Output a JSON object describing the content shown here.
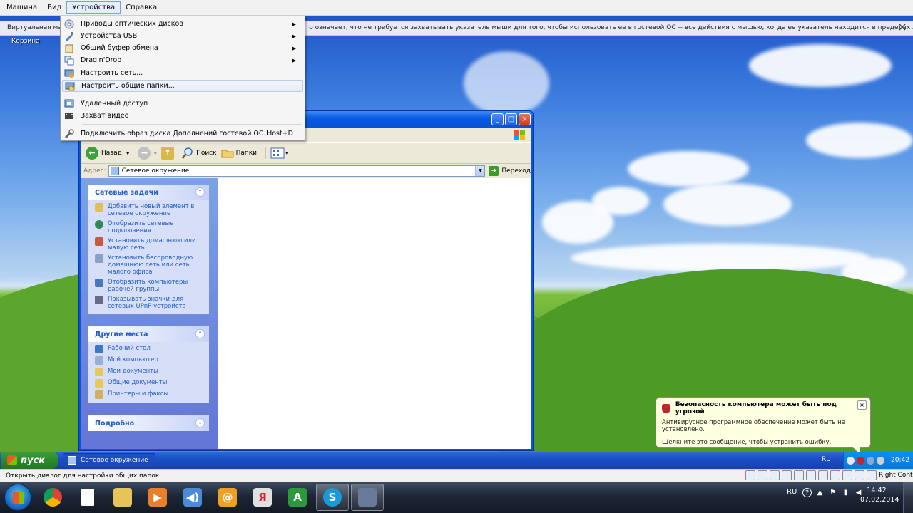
{
  "vbox_menu": {
    "items": [
      "Машина",
      "Вид",
      "Устройства",
      "Справка"
    ],
    "active_index": 2
  },
  "vbox_notice": {
    "text_left": "Виртуальная маш",
    "text_right": "то означает, что не требуется захватывать указатель мыши для того, чтобы использовать ее в гостевой ОС -- все действия с мышью, когда ее указатель находится в пределах экрана виртуальной"
  },
  "desktop": {
    "recycle_label": "Корзина"
  },
  "devices_menu": {
    "items": [
      {
        "label": "Приводы оптических дисков",
        "submenu": true,
        "icon": "optical-disc-icon"
      },
      {
        "label": "Устройства USB",
        "submenu": true,
        "icon": "usb-icon"
      },
      {
        "label": "Общий буфер обмена",
        "submenu": true,
        "icon": "clipboard-icon"
      },
      {
        "label": "Drag'n'Drop",
        "submenu": true,
        "icon": "drag-drop-icon"
      },
      {
        "label": "Настроить сеть...",
        "submenu": false,
        "icon": "network-settings-icon"
      },
      {
        "label": "Настроить общие папки...",
        "submenu": false,
        "icon": "shared-folders-icon"
      },
      {
        "label": "Удаленный доступ",
        "submenu": false,
        "icon": "remote-display-icon"
      },
      {
        "label": "Захват видео",
        "submenu": false,
        "icon": "video-capture-icon"
      },
      {
        "label": "Подключить образ диска Дополнений гостевой ОС...",
        "submenu": false,
        "icon": "guest-additions-icon",
        "shortcut": "Host+D"
      }
    ],
    "hover_index": 5
  },
  "explorer": {
    "toolbar": {
      "back_label": "Назад",
      "search_label": "Поиск",
      "folders_label": "Папки"
    },
    "address": {
      "label": "Адрес:",
      "value": "Сетевое окружение",
      "go_label": "Переход"
    },
    "network_tasks": {
      "title": "Сетевые задачи",
      "items": [
        "Добавить новый элемент в сетевое окружение",
        "Отобразить сетевые подключения",
        "Установить домашнюю или малую сеть",
        "Установить беспроводную домашнюю сеть или сеть малого офиса",
        "Отобразить компьютеры рабочей группы",
        "Показывать значки для сетевых UPnP-устройств"
      ]
    },
    "other_places": {
      "title": "Другие места",
      "items": [
        "Рабочий стол",
        "Мой компьютер",
        "Мои документы",
        "Общие документы",
        "Принтеры и факсы"
      ]
    },
    "details": {
      "title": "Подробно"
    }
  },
  "balloon": {
    "title": "Безопасность компьютера может быть под угрозой",
    "line1": "Антивирусное программное обеспечение может быть не установлено.",
    "line2": "Щелкните это сообщение, чтобы устранить ошибку."
  },
  "xp_taskbar": {
    "start_label": "пуск",
    "task_label": "Сетевое окружение",
    "lang": "RU",
    "time": "20:42"
  },
  "vbox_status": {
    "text": "Открыть диалог для настройки общих папок",
    "host_key": "Right Control"
  },
  "win7_taskbar": {
    "lang": "RU",
    "time": "14:42",
    "date": "07.02.2014",
    "pins": [
      "chrome-icon",
      "document-icon",
      "explorer-folder-icon",
      "media-player-icon",
      "sound-icon",
      "mail-agent-icon",
      "yandex-icon",
      "a-app-icon",
      "skype-icon",
      "virtualbox-icon"
    ],
    "pin_glyphs": [
      "",
      "",
      "",
      "▶",
      "◀)",
      "@",
      "Я",
      "A",
      "S",
      ""
    ]
  }
}
